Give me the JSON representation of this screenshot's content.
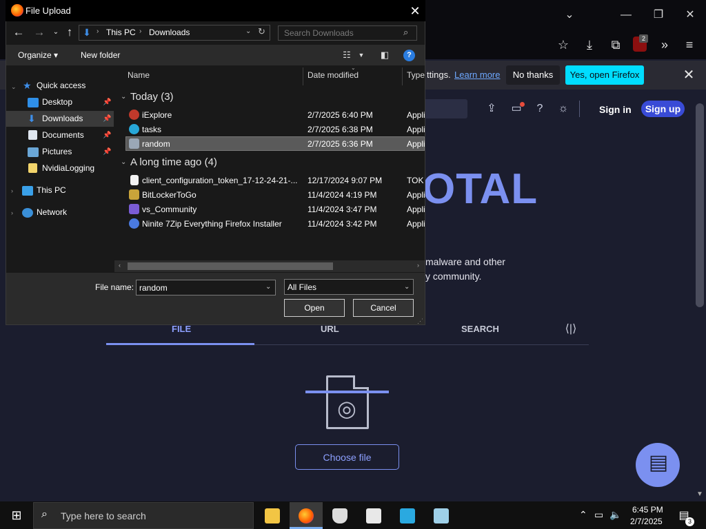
{
  "browser": {
    "notification": {
      "text": "ttings.",
      "link": "Learn more",
      "no_thanks": "No thanks",
      "yes": "Yes, open Firefox"
    },
    "ublock_badge": "2"
  },
  "site": {
    "sign_in": "Sign in",
    "sign_up": "Sign up",
    "logo_fragment": "OTAL",
    "desc_line1": "malware and other",
    "desc_line2": "y community.",
    "tabs": [
      "FILE",
      "URL",
      "SEARCH"
    ],
    "choose_file": "Choose file"
  },
  "dialog": {
    "title": "File Upload",
    "breadcrumb": [
      "This PC",
      "Downloads"
    ],
    "search_placeholder": "Search Downloads",
    "organize": "Organize",
    "new_folder": "New folder",
    "sidebar": {
      "quick_access": "Quick access",
      "items": [
        "Desktop",
        "Downloads",
        "Documents",
        "Pictures",
        "NvidiaLogging"
      ],
      "this_pc": "This PC",
      "network": "Network"
    },
    "columns": [
      "Name",
      "Date modified",
      "Type"
    ],
    "groups": [
      {
        "label": "Today (3)",
        "files": [
          {
            "name": "iExplore",
            "date": "2/7/2025 6:40 PM",
            "type": "Appli"
          },
          {
            "name": "tasks",
            "date": "2/7/2025 6:38 PM",
            "type": "Appli"
          },
          {
            "name": "random",
            "date": "2/7/2025 6:36 PM",
            "type": "Appli"
          }
        ]
      },
      {
        "label": "A long time ago (4)",
        "files": [
          {
            "name": "client_configuration_token_17-12-24-21-...",
            "date": "12/17/2024 9:07 PM",
            "type": "TOK"
          },
          {
            "name": "BitLockerToGo",
            "date": "11/4/2024 4:19 PM",
            "type": "Appli"
          },
          {
            "name": "vs_Community",
            "date": "11/4/2024 3:47 PM",
            "type": "Appli"
          },
          {
            "name": "Ninite 7Zip Everything Firefox Installer",
            "date": "11/4/2024 3:42 PM",
            "type": "Appli"
          }
        ]
      }
    ],
    "file_name_label": "File name:",
    "file_name_value": "random",
    "filter": "All Files",
    "open": "Open",
    "cancel": "Cancel"
  },
  "taskbar": {
    "search": "Type here to search",
    "time": "6:45 PM",
    "date": "2/7/2025",
    "notifications": "3"
  }
}
